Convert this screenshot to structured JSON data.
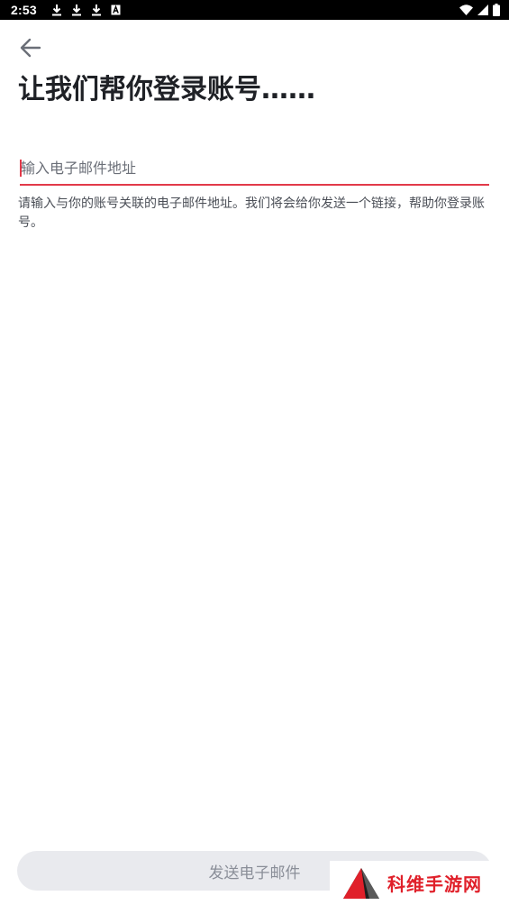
{
  "status_bar": {
    "time": "2:53",
    "left_icons": [
      "download-icon",
      "download-icon",
      "download-icon",
      "a-badge-icon"
    ],
    "right_icons": [
      "wifi-icon",
      "signal-icon",
      "battery-icon"
    ]
  },
  "header": {
    "back_icon": "arrow-left-icon",
    "title": "让我们帮你登录账号……"
  },
  "email_field": {
    "value": "",
    "placeholder": "输入电子邮件地址"
  },
  "helper_text": "请输入与你的账号关联的电子邮件地址。我们将会给你发送一个链接，帮助你登录账号。",
  "send_button": {
    "label": "发送电子邮件"
  },
  "watermark": {
    "text": "科维手游网",
    "icon": "triangle-logo-icon"
  },
  "colors": {
    "accent": "#e23a4a",
    "title": "#1f2126",
    "helper": "#4b4f57",
    "button_bg": "#e9eaee",
    "button_text": "#8a8e98",
    "watermark": "#e0202a"
  }
}
